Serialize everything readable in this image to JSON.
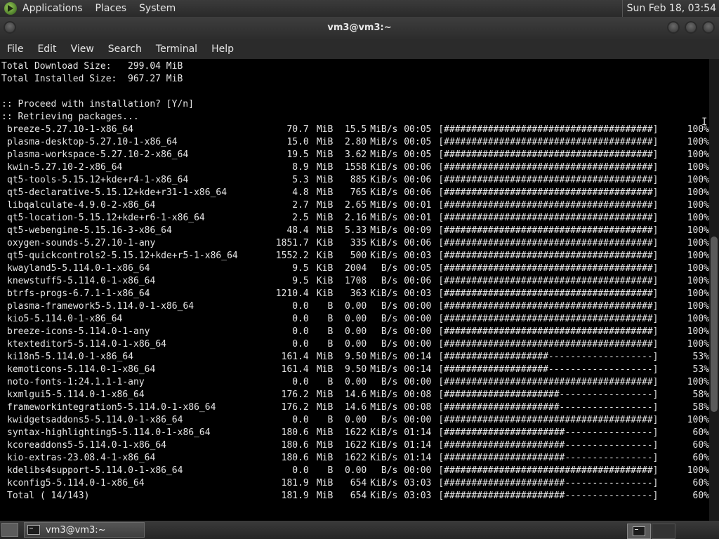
{
  "top_panel": {
    "menus": [
      "Applications",
      "Places",
      "System"
    ],
    "clock": "Sun Feb 18, 03:54"
  },
  "window": {
    "title": "vm3@vm3:~",
    "menubar": [
      "File",
      "Edit",
      "View",
      "Search",
      "Terminal",
      "Help"
    ]
  },
  "terminal": {
    "header_lines": [
      "Total Download Size:   299.04 MiB",
      "Total Installed Size:  967.27 MiB",
      "",
      ":: Proceed with installation? [Y/n]",
      ":: Retrieving packages..."
    ],
    "packages": [
      {
        "name": "breeze-5.27.10-1-x86_64",
        "size": "70.7",
        "unit": "MiB",
        "rate": "15.5",
        "rate_unit": "MiB/s",
        "time": "00:05",
        "bar": "[######################################]",
        "pct": "100%"
      },
      {
        "name": "plasma-desktop-5.27.10-1-x86_64",
        "size": "15.0",
        "unit": "MiB",
        "rate": "2.80",
        "rate_unit": "MiB/s",
        "time": "00:05",
        "bar": "[######################################]",
        "pct": "100%"
      },
      {
        "name": "plasma-workspace-5.27.10-2-x86_64",
        "size": "19.5",
        "unit": "MiB",
        "rate": "3.62",
        "rate_unit": "MiB/s",
        "time": "00:05",
        "bar": "[######################################]",
        "pct": "100%"
      },
      {
        "name": "kwin-5.27.10-2-x86_64",
        "size": "8.9",
        "unit": "MiB",
        "rate": "1558",
        "rate_unit": "KiB/s",
        "time": "00:06",
        "bar": "[######################################]",
        "pct": "100%"
      },
      {
        "name": "qt5-tools-5.15.12+kde+r4-1-x86_64",
        "size": "5.3",
        "unit": "MiB",
        "rate": "885",
        "rate_unit": "KiB/s",
        "time": "00:06",
        "bar": "[######################################]",
        "pct": "100%"
      },
      {
        "name": "qt5-declarative-5.15.12+kde+r31-1-x86_64",
        "size": "4.8",
        "unit": "MiB",
        "rate": "765",
        "rate_unit": "KiB/s",
        "time": "00:06",
        "bar": "[######################################]",
        "pct": "100%"
      },
      {
        "name": "libqalculate-4.9.0-2-x86_64",
        "size": "2.7",
        "unit": "MiB",
        "rate": "2.65",
        "rate_unit": "MiB/s",
        "time": "00:01",
        "bar": "[######################################]",
        "pct": "100%"
      },
      {
        "name": "qt5-location-5.15.12+kde+r6-1-x86_64",
        "size": "2.5",
        "unit": "MiB",
        "rate": "2.16",
        "rate_unit": "MiB/s",
        "time": "00:01",
        "bar": "[######################################]",
        "pct": "100%"
      },
      {
        "name": "qt5-webengine-5.15.16-3-x86_64",
        "size": "48.4",
        "unit": "MiB",
        "rate": "5.33",
        "rate_unit": "MiB/s",
        "time": "00:09",
        "bar": "[######################################]",
        "pct": "100%"
      },
      {
        "name": "oxygen-sounds-5.27.10-1-any",
        "size": "1851.7",
        "unit": "KiB",
        "rate": "335",
        "rate_unit": "KiB/s",
        "time": "00:06",
        "bar": "[######################################]",
        "pct": "100%"
      },
      {
        "name": "qt5-quickcontrols2-5.15.12+kde+r5-1-x86_64",
        "size": "1552.2",
        "unit": "KiB",
        "rate": "500",
        "rate_unit": "KiB/s",
        "time": "00:03",
        "bar": "[######################################]",
        "pct": "100%"
      },
      {
        "name": "kwayland5-5.114.0-1-x86_64",
        "size": "9.5",
        "unit": "KiB",
        "rate": "2004",
        "rate_unit": "B/s",
        "time": "00:05",
        "bar": "[######################################]",
        "pct": "100%"
      },
      {
        "name": "knewstuff5-5.114.0-1-x86_64",
        "size": "9.5",
        "unit": "KiB",
        "rate": "1708",
        "rate_unit": "B/s",
        "time": "00:06",
        "bar": "[######################################]",
        "pct": "100%"
      },
      {
        "name": "btrfs-progs-6.7.1-1-x86_64",
        "size": "1210.4",
        "unit": "KiB",
        "rate": "363",
        "rate_unit": "KiB/s",
        "time": "00:03",
        "bar": "[######################################]",
        "pct": "100%"
      },
      {
        "name": "plasma-framework5-5.114.0-1-x86_64",
        "size": "0.0",
        "unit": "B",
        "rate": "0.00",
        "rate_unit": "B/s",
        "time": "00:00",
        "bar": "[######################################]",
        "pct": "100%"
      },
      {
        "name": "kio5-5.114.0-1-x86_64",
        "size": "0.0",
        "unit": "B",
        "rate": "0.00",
        "rate_unit": "B/s",
        "time": "00:00",
        "bar": "[######################################]",
        "pct": "100%"
      },
      {
        "name": "breeze-icons-5.114.0-1-any",
        "size": "0.0",
        "unit": "B",
        "rate": "0.00",
        "rate_unit": "B/s",
        "time": "00:00",
        "bar": "[######################################]",
        "pct": "100%"
      },
      {
        "name": "ktexteditor5-5.114.0-1-x86_64",
        "size": "0.0",
        "unit": "B",
        "rate": "0.00",
        "rate_unit": "B/s",
        "time": "00:00",
        "bar": "[######################################]",
        "pct": "100%"
      },
      {
        "name": "ki18n5-5.114.0-1-x86_64",
        "size": "161.4",
        "unit": "MiB",
        "rate": "9.50",
        "rate_unit": "MiB/s",
        "time": "00:14",
        "bar": "[###################-------------------]",
        "pct": "53%"
      },
      {
        "name": "kemoticons-5.114.0-1-x86_64",
        "size": "161.4",
        "unit": "MiB",
        "rate": "9.50",
        "rate_unit": "MiB/s",
        "time": "00:14",
        "bar": "[###################-------------------]",
        "pct": "53%"
      },
      {
        "name": "noto-fonts-1:24.1.1-1-any",
        "size": "0.0",
        "unit": "B",
        "rate": "0.00",
        "rate_unit": "B/s",
        "time": "00:00",
        "bar": "[######################################]",
        "pct": "100%"
      },
      {
        "name": "kxmlgui5-5.114.0-1-x86_64",
        "size": "176.2",
        "unit": "MiB",
        "rate": "14.6",
        "rate_unit": "MiB/s",
        "time": "00:08",
        "bar": "[#####################-----------------]",
        "pct": "58%"
      },
      {
        "name": "frameworkintegration5-5.114.0-1-x86_64",
        "size": "176.2",
        "unit": "MiB",
        "rate": "14.6",
        "rate_unit": "MiB/s",
        "time": "00:08",
        "bar": "[#####################-----------------]",
        "pct": "58%"
      },
      {
        "name": "kwidgetsaddons5-5.114.0-1-x86_64",
        "size": "0.0",
        "unit": "B",
        "rate": "0.00",
        "rate_unit": "B/s",
        "time": "00:00",
        "bar": "[######################################]",
        "pct": "100%"
      },
      {
        "name": "syntax-highlighting5-5.114.0-1-x86_64",
        "size": "180.6",
        "unit": "MiB",
        "rate": "1622",
        "rate_unit": "KiB/s",
        "time": "01:14",
        "bar": "[######################----------------]",
        "pct": "60%"
      },
      {
        "name": "kcoreaddons5-5.114.0-1-x86_64",
        "size": "180.6",
        "unit": "MiB",
        "rate": "1622",
        "rate_unit": "KiB/s",
        "time": "01:14",
        "bar": "[######################----------------]",
        "pct": "60%"
      },
      {
        "name": "kio-extras-23.08.4-1-x86_64",
        "size": "180.6",
        "unit": "MiB",
        "rate": "1622",
        "rate_unit": "KiB/s",
        "time": "01:14",
        "bar": "[######################----------------]",
        "pct": "60%"
      },
      {
        "name": "kdelibs4support-5.114.0-1-x86_64",
        "size": "0.0",
        "unit": "B",
        "rate": "0.00",
        "rate_unit": "B/s",
        "time": "00:00",
        "bar": "[######################################]",
        "pct": "100%"
      },
      {
        "name": "kconfig5-5.114.0-1-x86_64",
        "size": "181.9",
        "unit": "MiB",
        "rate": "654",
        "rate_unit": "KiB/s",
        "time": "03:03",
        "bar": "[######################----------------]",
        "pct": "60%"
      },
      {
        "name": "Total ( 14/143)",
        "size": "181.9",
        "unit": "MiB",
        "rate": "654",
        "rate_unit": "KiB/s",
        "time": "03:03",
        "bar": "[######################----------------]",
        "pct": "60%"
      }
    ],
    "scroll_position": 0.62
  },
  "bottom_panel": {
    "taskbar_item": "vm3@vm3:~"
  }
}
